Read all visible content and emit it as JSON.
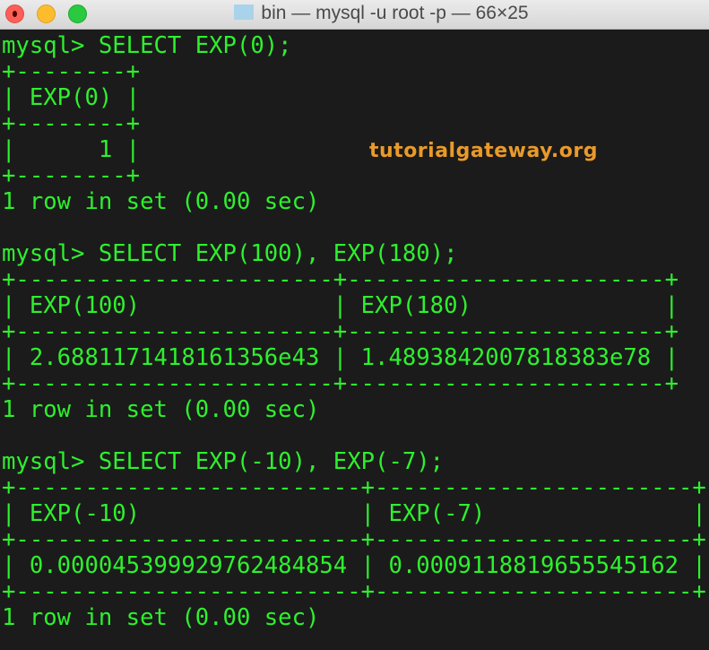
{
  "window": {
    "title": "bin — mysql -u root -p — 66×25"
  },
  "watermark": "tutorialgateway.org",
  "queries": [
    {
      "prompt": "mysql> SELECT EXP(0);",
      "table": [
        "+--------+",
        "| EXP(0) |",
        "+--------+",
        "|      1 |",
        "+--------+"
      ],
      "status": "1 row in set (0.00 sec)"
    },
    {
      "prompt": "mysql> SELECT EXP(100), EXP(180);",
      "table": [
        "+-----------------------+-----------------------+",
        "| EXP(100)              | EXP(180)              |",
        "+-----------------------+-----------------------+",
        "| 2.6881171418161356e43 | 1.4893842007818383e78 |",
        "+-----------------------+-----------------------+"
      ],
      "status": "1 row in set (0.00 sec)"
    },
    {
      "prompt": "mysql> SELECT EXP(-10), EXP(-7);",
      "table": [
        "+-------------------------+-----------------------+",
        "| EXP(-10)                | EXP(-7)               |",
        "+-------------------------+-----------------------+",
        "| 0.000045399929762484854 | 0.0009118819655545162 |",
        "+-------------------------+-----------------------+"
      ],
      "status": "1 row in set (0.00 sec)"
    }
  ]
}
